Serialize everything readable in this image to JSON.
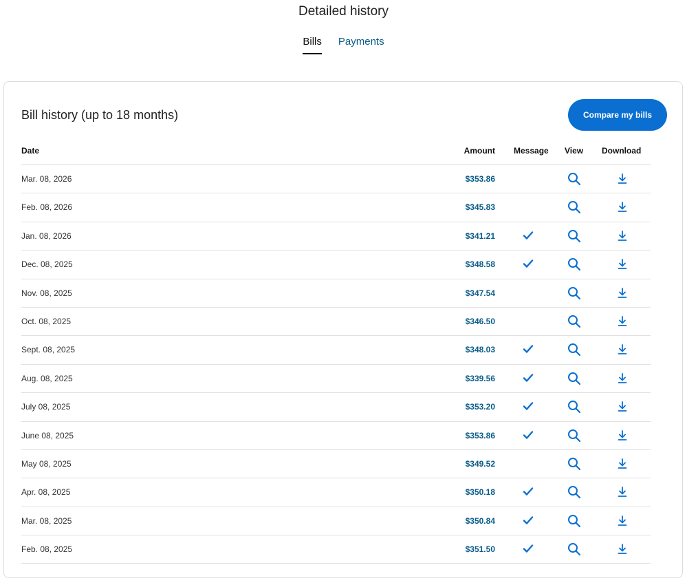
{
  "header": {
    "title": "Detailed history"
  },
  "tabs": [
    {
      "label": "Bills",
      "active": true
    },
    {
      "label": "Payments",
      "active": false
    }
  ],
  "card": {
    "title": "Bill history (up to 18 months)",
    "compare_label": "Compare my bills"
  },
  "table": {
    "columns": {
      "date": "Date",
      "amount": "Amount",
      "message": "Message",
      "view": "View",
      "download": "Download"
    },
    "rows": [
      {
        "date": "Mar. 08, 2026",
        "amount": "$353.86",
        "message": false
      },
      {
        "date": "Feb. 08, 2026",
        "amount": "$345.83",
        "message": false
      },
      {
        "date": "Jan. 08, 2026",
        "amount": "$341.21",
        "message": true
      },
      {
        "date": "Dec. 08, 2025",
        "amount": "$348.58",
        "message": true
      },
      {
        "date": "Nov. 08, 2025",
        "amount": "$347.54",
        "message": false
      },
      {
        "date": "Oct. 08, 2025",
        "amount": "$346.50",
        "message": false
      },
      {
        "date": "Sept. 08, 2025",
        "amount": "$348.03",
        "message": true
      },
      {
        "date": "Aug. 08, 2025",
        "amount": "$339.56",
        "message": true
      },
      {
        "date": "July 08, 2025",
        "amount": "$353.20",
        "message": true
      },
      {
        "date": "June 08, 2025",
        "amount": "$353.86",
        "message": true
      },
      {
        "date": "May 08, 2025",
        "amount": "$349.52",
        "message": false
      },
      {
        "date": "Apr. 08, 2025",
        "amount": "$350.18",
        "message": true
      },
      {
        "date": "Mar. 08, 2025",
        "amount": "$350.84",
        "message": true
      },
      {
        "date": "Feb. 08, 2025",
        "amount": "$351.50",
        "message": true
      }
    ]
  },
  "icons": {
    "message": "check-icon",
    "view": "search-icon",
    "download": "download-icon"
  },
  "colors": {
    "accent": "#0a6fd1",
    "link": "#0a5c8a",
    "icon": "#0a6fd1"
  }
}
